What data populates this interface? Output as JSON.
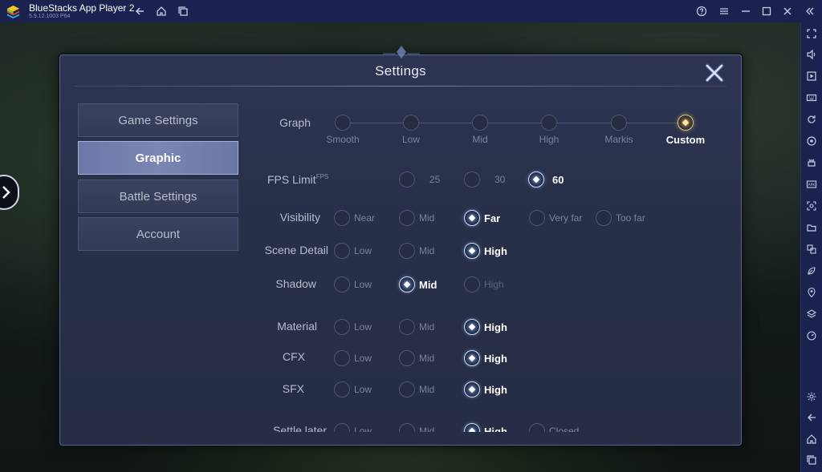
{
  "app": {
    "title": "BlueStacks App Player 2",
    "version": "5.9.12.1003  P64"
  },
  "titlebar_icons": [
    "back-icon",
    "home-icon",
    "multi-window-icon",
    "help-icon",
    "menu-icon",
    "minimize-icon",
    "maximize-icon",
    "close-icon",
    "collapse-sidebar-icon"
  ],
  "sidebar_icons": [
    "fullscreen-icon",
    "volume-icon",
    "media-icon",
    "keyboard-icon",
    "rotate-icon",
    "macro-icon",
    "apk-icon",
    "apk-install-icon",
    "screenshot-icon",
    "folder-icon",
    "multi-instance-icon",
    "eco-mode-icon",
    "location-icon",
    "layers-icon",
    "performance-icon",
    "settings-icon",
    "back-icon",
    "home-icon",
    "recent-apps-icon"
  ],
  "settings": {
    "title": "Settings",
    "menu": [
      {
        "label": "Game Settings",
        "active": false
      },
      {
        "label": "Graphic",
        "active": true
      },
      {
        "label": "Battle Settings",
        "active": false
      },
      {
        "label": "Account",
        "active": false
      }
    ],
    "graph": {
      "label": "Graph",
      "options": [
        "Smooth",
        "Low",
        "Mid",
        "High",
        "Markis",
        "Custom"
      ],
      "selected": "Custom"
    },
    "fps": {
      "label": "FPS Limit",
      "suffix": "FPS",
      "options": [
        "25",
        "30",
        "60"
      ],
      "selected": "60"
    },
    "rows": [
      {
        "label": "Visibility",
        "options": [
          "Near",
          "Mid",
          "Far",
          "Very far",
          "Too far"
        ],
        "selected": "Far"
      },
      {
        "label": "Scene Detail",
        "options": [
          "Low",
          "Mid",
          "High"
        ],
        "selected": "High"
      },
      {
        "label": "Shadow",
        "options": [
          "Low",
          "Mid",
          "High"
        ],
        "selected": "Mid"
      },
      {
        "label": "Material",
        "options": [
          "Low",
          "Mid",
          "High"
        ],
        "selected": "High"
      },
      {
        "label": "CFX",
        "options": [
          "Low",
          "Mid",
          "High"
        ],
        "selected": "High"
      },
      {
        "label": "SFX",
        "options": [
          "Low",
          "Mid",
          "High"
        ],
        "selected": "High"
      },
      {
        "label": "Settle later",
        "options": [
          "Low",
          "Mid",
          "High",
          "Closed"
        ],
        "selected": "High"
      }
    ]
  },
  "colors": {
    "chrome": "#1b2250",
    "panel": "#2a3249",
    "active_tab": "#7580ad",
    "selected_text": "#ffffff",
    "custom_glow": "#ffd36a"
  }
}
